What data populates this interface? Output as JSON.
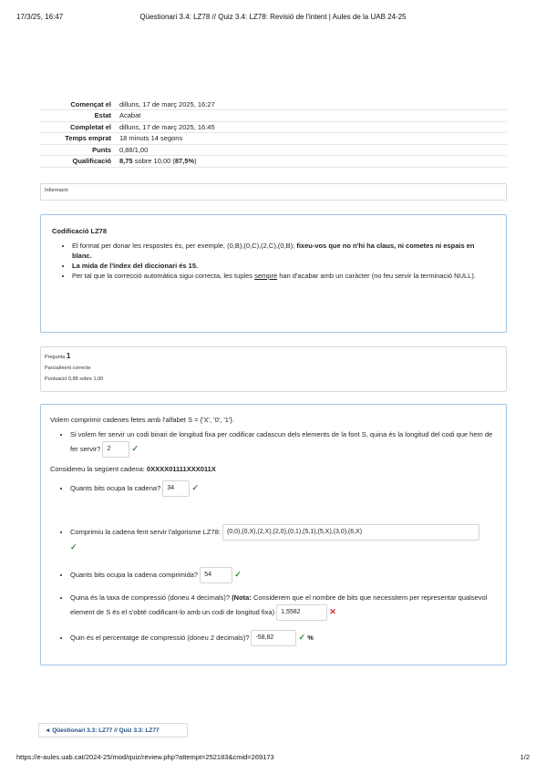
{
  "print_header": {
    "datetime": "17/3/25, 16:47",
    "title": "Qüestionari 3.4: LZ78 // Quiz 3.4: LZ78: Revisió de l'intent | Aules de la UAB 24-25"
  },
  "summary": [
    {
      "label": "Començat el",
      "value": "dilluns, 17 de març 2025, 16:27"
    },
    {
      "label": "Estat",
      "value": "Acabat"
    },
    {
      "label": "Completat el",
      "value": "dilluns, 17 de març 2025, 16:45"
    },
    {
      "label": "Temps emprat",
      "value": "18 minuts 14 segons"
    },
    {
      "label": "Punts",
      "value": "0,88/1,00"
    },
    {
      "label": "Qualificació",
      "grade": "8,75",
      "grade_mid": " sobre 10,00 (",
      "grade_pct": "87,5%",
      "grade_end": ")"
    }
  ],
  "info_label": "Informació",
  "info": {
    "heading": "Codificació LZ78",
    "item1_text": "El format per donar les respostes és, per exemple, (0,B),(0,C),(2,C),(0,B); ",
    "item1_bold": "fixeu-vos que no n'hi ha claus, ni cometes ni espais en blanc.",
    "item2": "La mida de l'índex del diccionari és 15.",
    "item3_pre": "Per tal que la correcció automàtica sigui correcta, les tuples ",
    "item3_u": "sempre",
    "item3_post": " han d'acabar amb un caràcter (no feu servir la terminació NULL)."
  },
  "question_info": {
    "label": "Pregunta",
    "number": "1",
    "state": "Parcialment correcte",
    "score": "Puntuació 0,88 sobre 1,00"
  },
  "question": {
    "intro": "Volem comprimir cadenes fetes amb l'alfabet S = {'X', '0', '1'}.",
    "q1_text": "Si volem fer servir un codi binari de longitud fixa per codificar cadascun dels elements de la font S, quina és la longitud del codi que hem de fer servir?",
    "q1_answer": "2",
    "consider_pre": "Considereu la següent cadena: ",
    "consider_string": "0XXXX01111XXX011X",
    "q2_text": "Quants bits ocupa la cadena?",
    "q2_answer": "34",
    "q3_text": "Comprimiu la cadena fent servir l'algorisme LZ78:",
    "q3_answer": "(0,0),(0,X),(2,X),(2,0),(0,1),(5,1),(5,X),(3,0),(6,X)",
    "q4_text": "Quants bits ocupa la cadena comprimida?",
    "q4_answer": "54",
    "q5_text_pre": "Quina és la taxa de compressió (doneu 4 decimals)? ",
    "q5_note_bold": "(Nota:",
    "q5_note_text": " Considerem que el nombre de bits que necessitem per representar qualsevol element de S és el s'obté codificant-lo amb un codi de longitud fixa)",
    "q5_answer": "1,5582",
    "q6_text": "Quin és el percentatge de compressió (doneu 2 decimals)?",
    "q6_answer": "-58,82",
    "q6_unit": "%"
  },
  "nav_link": "◄ Qüestionari 3.3: LZ77 // Quiz 3.3: LZ77",
  "print_footer": {
    "url": "https://e-aules.uab.cat/2024-25/mod/quiz/review.php?attempt=252183&cmid=269173",
    "page": "1/2"
  },
  "marks": {
    "correct": "✓",
    "incorrect": "✕"
  }
}
